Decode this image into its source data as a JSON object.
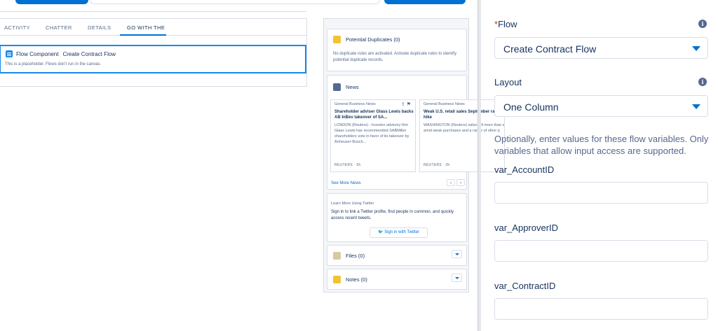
{
  "record_tabs": [
    {
      "label": "ACTIVITY",
      "active": false
    },
    {
      "label": "CHATTER",
      "active": false
    },
    {
      "label": "DETAILS",
      "active": false
    },
    {
      "label": "GO WITH THE",
      "active": true
    }
  ],
  "flow_component": {
    "title": "Flow Component",
    "flow_name": "Create Contract Flow",
    "description": "This is a placeholder. Flows don't run in the canvas."
  },
  "potential_duplicates": {
    "title": "Potential Duplicates (0)",
    "message": "No duplicate rules are activated. Activate duplicate rules to identify potential duplicate records."
  },
  "news": {
    "title": "News",
    "items": [
      {
        "source": "General Business News",
        "headline": "Shareholder adviser Glass Lewis backs AB InBev takeover of SA...",
        "body": "LONDON (Reuters) - Investor advisory firm Glass Lewis has recommended SABMiller shareholders vote in favor of its takeover by Anheuser-Busch...",
        "footer": "REUTERS · 5h"
      },
      {
        "source": "General Business News",
        "headline": "Weak U.S. retail sales September rate hike",
        "body": "WASHINGTON (Reuters) sales fell more than e amid weak purchases and a range of other p",
        "footer": "REUTERS · 2h"
      }
    ],
    "see_more": "See More News"
  },
  "twitter": {
    "heading": "Learn More Using Twitter",
    "message": "Sign in to link a Twitter profile, find people in common, and quickly access recent tweets.",
    "button": "Sign in with Twitter"
  },
  "files": {
    "title": "Files (0)"
  },
  "notes": {
    "title": "Notes (0)"
  },
  "properties": {
    "flow_label": "Flow",
    "flow_required_mark": "*",
    "flow_value": "Create Contract Flow",
    "layout_label": "Layout",
    "layout_value": "One Column",
    "help_text": "Optionally, enter values for these flow variables. Only variables that allow input access are supported.",
    "variables": [
      {
        "label": "var_AccountID",
        "value": ""
      },
      {
        "label": "var_ApproverID",
        "value": ""
      },
      {
        "label": "var_ContractID",
        "value": ""
      }
    ]
  },
  "colors": {
    "brand_blue": "#0070d2",
    "selection_blue": "#1589ee",
    "text_dark": "#16325c",
    "text_muted": "#54698d",
    "border": "#d8dde6",
    "duplicates_icon": "#f2c335",
    "news_icon": "#54698d",
    "files_icon": "#d8c9a0",
    "notes_icon": "#f2c335"
  },
  "icons": {
    "flow": "flow-icon",
    "duplicates": "duplicates-icon",
    "news": "news-icon",
    "twitter": "twitter-bird-icon",
    "info": "info-icon",
    "dropdown": "chevron-down-icon"
  }
}
